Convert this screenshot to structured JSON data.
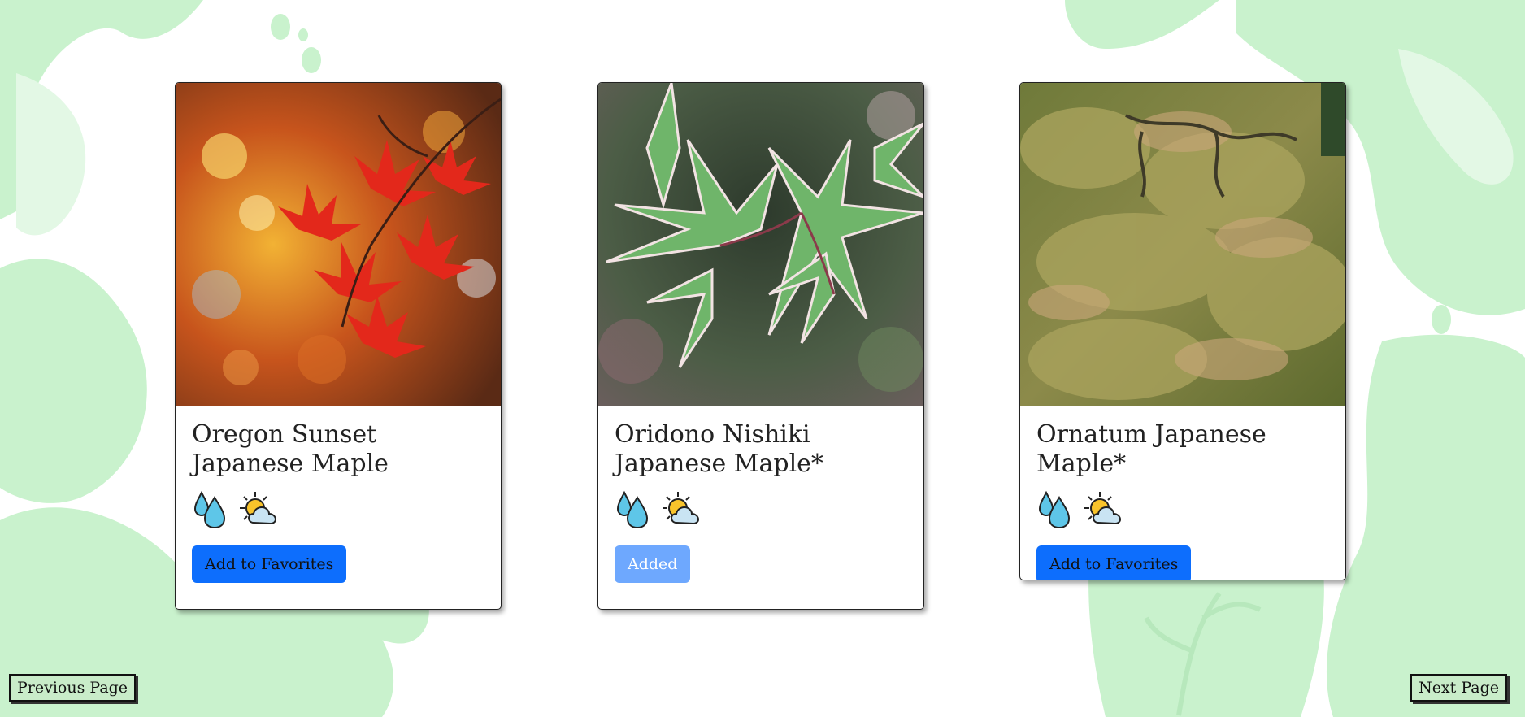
{
  "colors": {
    "background_leaf": "#c9f2cd",
    "primary_button": "#0d6efd",
    "primary_button_disabled": "#6ea8fe",
    "nav_button": "#c9ecc9"
  },
  "cards": [
    {
      "image_alt": "Red maple leaves with colorful autumn bokeh",
      "title": "Oregon Sunset Japanese Maple",
      "icons": [
        "water-drops-icon",
        "partly-sunny-icon"
      ],
      "button_label": "Add to Favorites",
      "button_state": "default"
    },
    {
      "image_alt": "Green and pink variegated maple leaves",
      "title": "Oridono Nishiki Japanese Maple*",
      "icons": [
        "water-drops-icon",
        "partly-sunny-icon"
      ],
      "button_label": "Added",
      "button_state": "added"
    },
    {
      "image_alt": "Weeping laceleaf maple tree canopy",
      "title": "Ornatum Japanese Maple*",
      "icons": [
        "water-drops-icon",
        "partly-sunny-icon"
      ],
      "button_label": "Add to Favorites",
      "button_state": "default"
    }
  ],
  "pagination": {
    "previous_label": "Previous Page",
    "next_label": "Next Page"
  }
}
